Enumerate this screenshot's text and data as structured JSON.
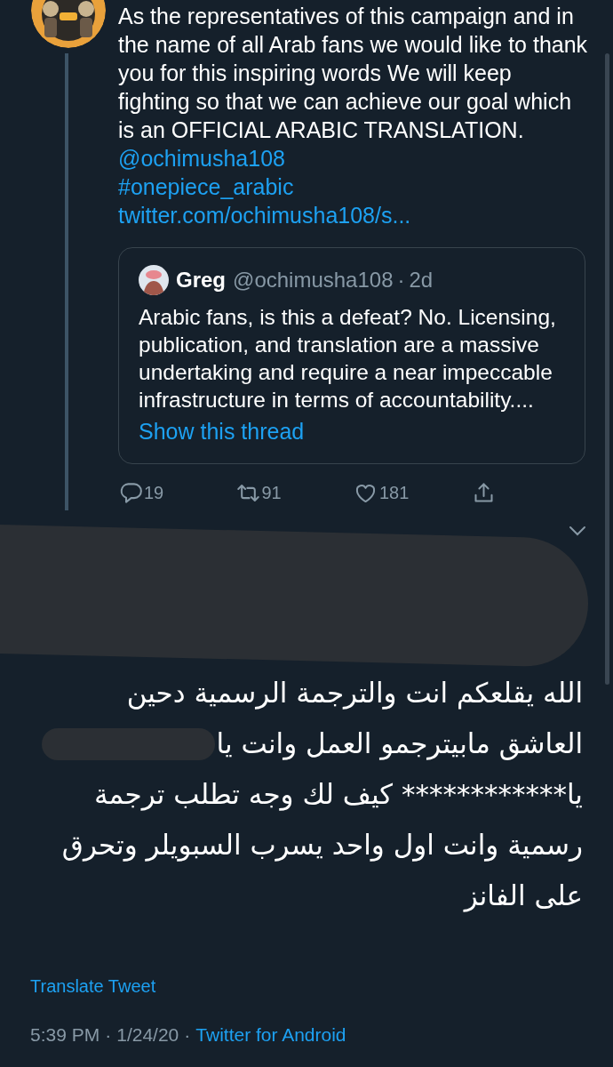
{
  "tweet": {
    "text": "As the representatives of this campaign and in the name of all Arab fans we would like to thank you for this inspiring words We will keep fighting so that we can achieve our goal which is an OFFICIAL ARABIC TRANSLATION.",
    "links": [
      "@ochimusha108",
      "#onepiece_arabic",
      "twitter.com/ochimusha108/s..."
    ],
    "quote": {
      "name": "Greg",
      "handle": "@ochimusha108",
      "separator": "·",
      "time": "2d",
      "text": "Arabic fans, is this a defeat? No. Licensing, publication, and translation are a massive undertaking and require a near impeccable infrastructure in terms of accountability....",
      "thread_link": "Show this thread"
    },
    "actions": [
      {
        "kind": "reply",
        "count": "19"
      },
      {
        "kind": "retweet",
        "count": "91"
      },
      {
        "kind": "like",
        "count": "181"
      },
      {
        "kind": "share"
      }
    ]
  },
  "reply": {
    "lines": [
      {
        "text": "الله يقلعكم انت والترجمة الرسمية دحين",
        "redacted": false
      },
      {
        "text": "العاشق مابيترجمو العمل وانت يا",
        "redacted": true
      },
      {
        "text": "يا************ كيف لك وجه تطلب ترجمة",
        "redacted": false
      },
      {
        "text": "رسمية وانت اول واحد يسرب السبويلر وتحرق",
        "redacted": false
      },
      {
        "text": "على الفانز",
        "redacted": false
      }
    ],
    "translate": "Translate Tweet",
    "meta": [
      {
        "kind": "plain",
        "text": "5:39 PM"
      },
      {
        "kind": "plain",
        "text": "·"
      },
      {
        "kind": "plain",
        "text": "1/24/20"
      },
      {
        "kind": "plain",
        "text": "·"
      },
      {
        "kind": "link",
        "text": "Twitter for Android"
      }
    ]
  }
}
